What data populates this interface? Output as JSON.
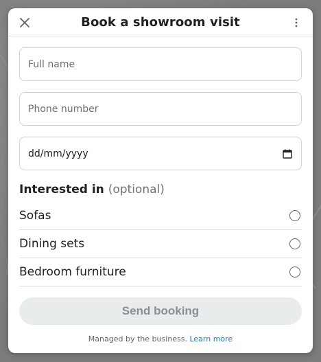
{
  "dialog": {
    "title": "Book a showroom visit",
    "close_icon": "close-icon",
    "more_icon": "more-vertical-icon"
  },
  "form": {
    "full_name_placeholder": "Full name",
    "phone_placeholder": "Phone number",
    "date_value": "dd/mm/yyyy",
    "calendar_icon": "calendar-icon"
  },
  "interests": {
    "title": "Interested in",
    "optional": "(optional)",
    "options": [
      {
        "label": "Sofas",
        "selected": false
      },
      {
        "label": "Dining sets",
        "selected": false
      },
      {
        "label": "Bedroom furniture",
        "selected": false
      }
    ]
  },
  "submit": {
    "label": "Send booking",
    "enabled": false
  },
  "footer": {
    "text": "Managed by the business.",
    "link": "Learn more"
  },
  "colors": {
    "link": "#1a73e8",
    "disabled_button_bg": "#e9eced",
    "disabled_button_text": "#8b8f93"
  }
}
